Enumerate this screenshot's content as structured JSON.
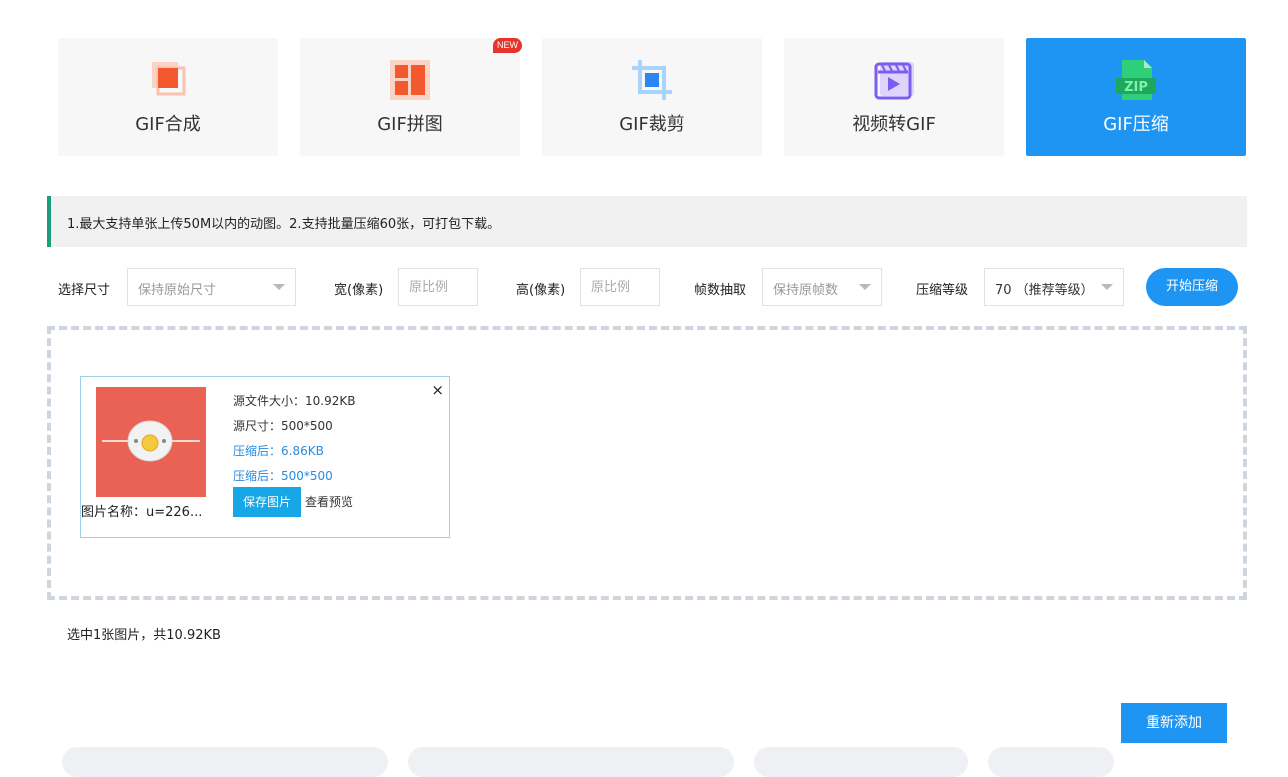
{
  "tabs": [
    {
      "label": "GIF合成",
      "icon": "layers-icon",
      "badge": ""
    },
    {
      "label": "GIF拼图",
      "icon": "puzzle-grid-icon",
      "badge": "NEW"
    },
    {
      "label": "GIF裁剪",
      "icon": "crop-icon",
      "badge": ""
    },
    {
      "label": "视频转GIF",
      "icon": "video-icon",
      "badge": ""
    },
    {
      "label": "GIF压缩",
      "icon": "zip-file-icon",
      "badge": "",
      "active": true
    }
  ],
  "notice": "1.最大支持单张上传50M以内的动图。2.支持批量压缩60张，可打包下载。",
  "options": {
    "size_label": "选择尺寸",
    "size_value": "保持原始尺寸",
    "width_label": "宽(像素)",
    "width_placeholder": "原比例",
    "height_label": "高(像素)",
    "height_placeholder": "原比例",
    "frame_label": "帧数抽取",
    "frame_value": "保持原帧数",
    "level_label": "压缩等级",
    "level_value": "70 （推荐等级）",
    "start_button": "开始压缩"
  },
  "file_card": {
    "source_size": "源文件大小：10.92KB",
    "source_dims": "源尺寸：500*500",
    "compressed_size": "压缩后：6.86KB",
    "compressed_dims": "压缩后：500*500",
    "save_button": "保存图片",
    "preview_link": "查看预览",
    "file_name": "图片名称：u=226...",
    "close": "×"
  },
  "summary": "选中1张图片，共10.92KB",
  "readd_button": "重新添加",
  "colors": {
    "accent": "#1e95f3",
    "notice_bar": "#1c9e7c",
    "thumb_bg": "#e96254",
    "badge_red": "#e8332a",
    "save_button": "#17a6e6"
  }
}
